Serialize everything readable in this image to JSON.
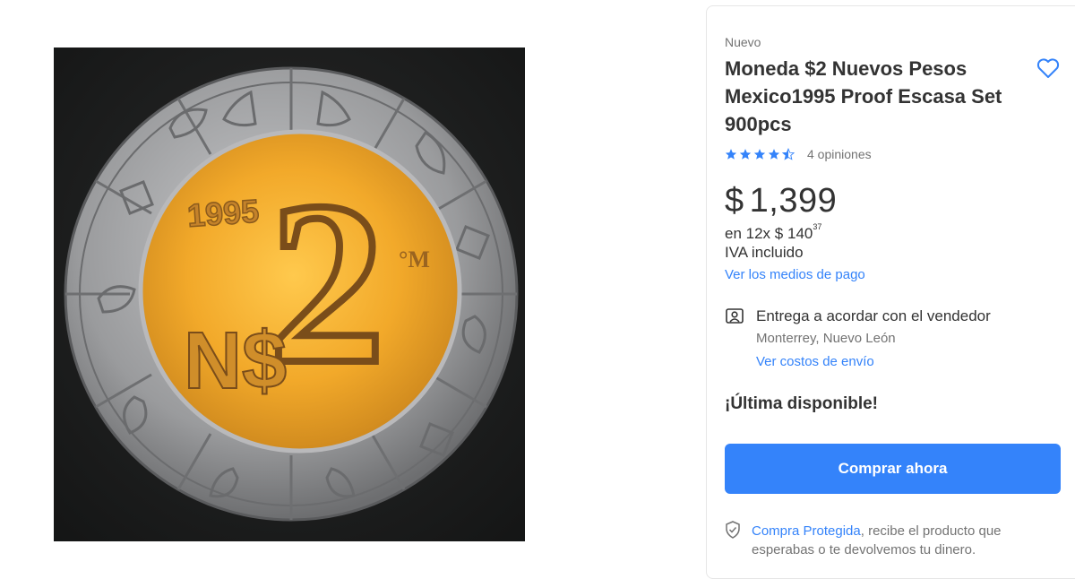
{
  "product": {
    "condition": "Nuevo",
    "title": "Moneda $2 Nuevos Pesos Mexico1995 Proof Escasa Set 900pcs",
    "rating": {
      "value": 4.5,
      "stars_max": 5,
      "reviews_text": "4 opiniones"
    },
    "price": {
      "currency": "$",
      "amount": "1,399"
    },
    "installments": {
      "prefix": "en 12x",
      "currency": "$",
      "amount": "140",
      "cents": "37"
    },
    "tax_note": "IVA incluido",
    "payment_link": "Ver los medios de pago",
    "favorite_icon": "heart-icon"
  },
  "shipping": {
    "icon": "person-card-icon",
    "title": "Entrega a acordar con el vendedor",
    "location": "Monterrey, Nuevo León",
    "costs_link": "Ver costos de envío"
  },
  "stock": {
    "label": "¡Última disponible!"
  },
  "buy_button": {
    "label": "Comprar ahora"
  },
  "protection": {
    "icon": "shield-check-icon",
    "link_text": "Compra Protegida",
    "text": ", recibe el producto que esperabas o te devolvemos tu dinero."
  },
  "coin_image": {
    "year": "1995",
    "denomination": "2",
    "currency_mark": "N$",
    "mint_mark": "°M"
  },
  "colors": {
    "accent": "#3483fa",
    "star": "#3483fa",
    "text_primary": "#333333",
    "text_secondary": "#737373",
    "coin_center": "#f0a92a",
    "coin_ring": "#8f9092",
    "photo_background": "#1c1d1d"
  }
}
